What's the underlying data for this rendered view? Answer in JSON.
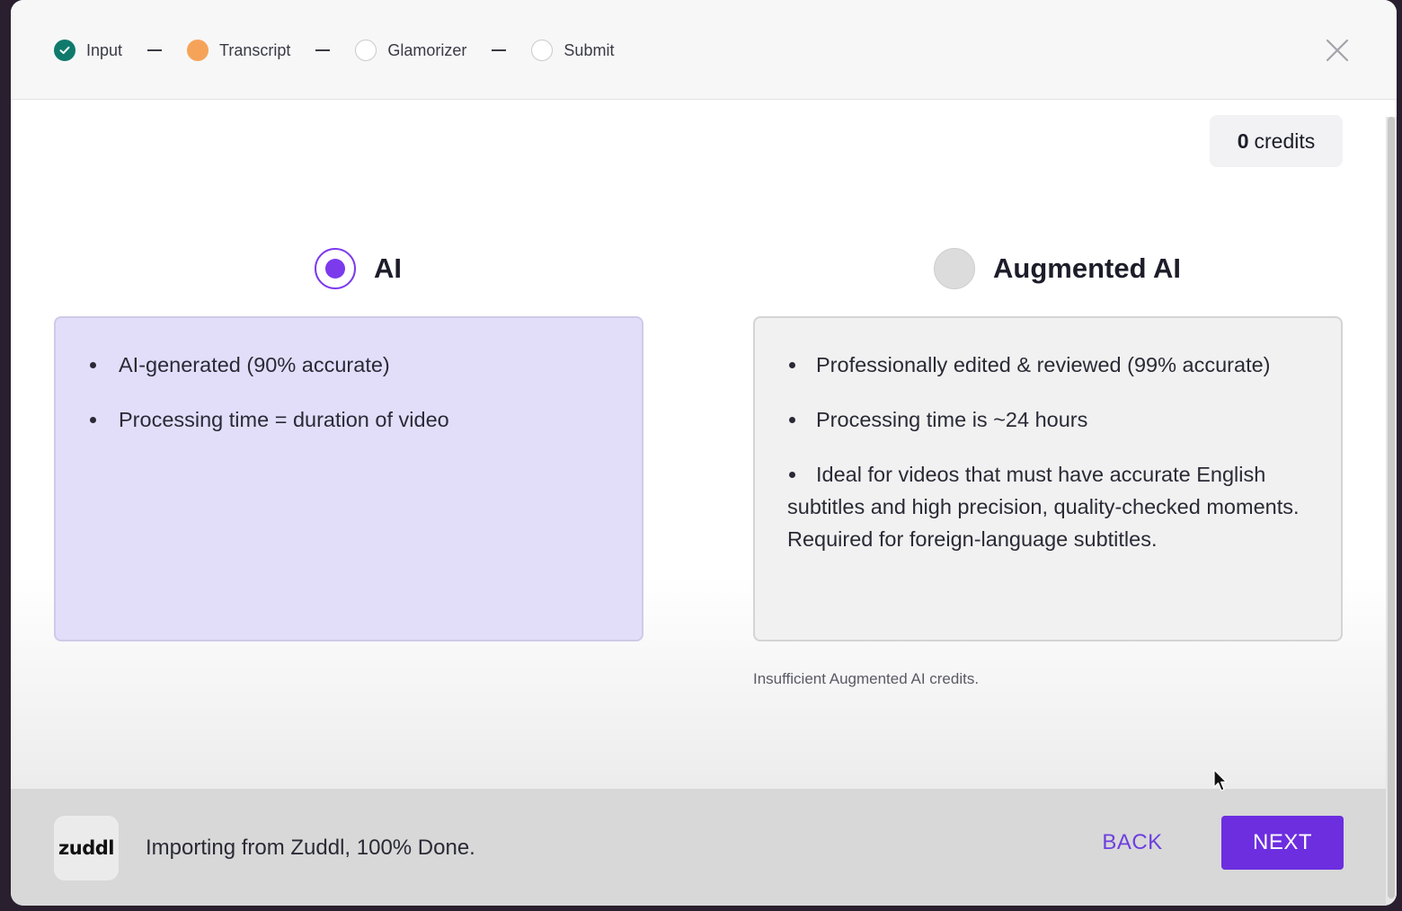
{
  "stepper": {
    "steps": [
      {
        "label": "Input",
        "state": "done"
      },
      {
        "label": "Transcript",
        "state": "active"
      },
      {
        "label": "Glamorizer",
        "state": "pending"
      },
      {
        "label": "Submit",
        "state": "pending"
      }
    ]
  },
  "credits": {
    "count": "0",
    "unit": "credits"
  },
  "options": {
    "ai": {
      "label": "AI",
      "selected": true,
      "features": [
        "AI-generated (90% accurate)",
        "Processing time = duration of video"
      ]
    },
    "augmented": {
      "label": "Augmented AI",
      "selected": false,
      "features": [
        "Professionally edited & reviewed (99% accurate)",
        "Processing time is ~24 hours",
        "Ideal for videos that must have accurate English subtitles and high precision, quality-checked moments. Required for foreign-language subtitles."
      ],
      "note": "Insufficient Augmented AI credits."
    }
  },
  "footer": {
    "logo_text": "zuddl",
    "status": "Importing from Zuddl, 100% Done.",
    "back_label": "BACK",
    "next_label": "NEXT"
  },
  "colors": {
    "accent": "#6d2ee0",
    "step_done": "#0f7a6c",
    "step_active": "#f6a35a",
    "selected_card": "#e2defa"
  }
}
